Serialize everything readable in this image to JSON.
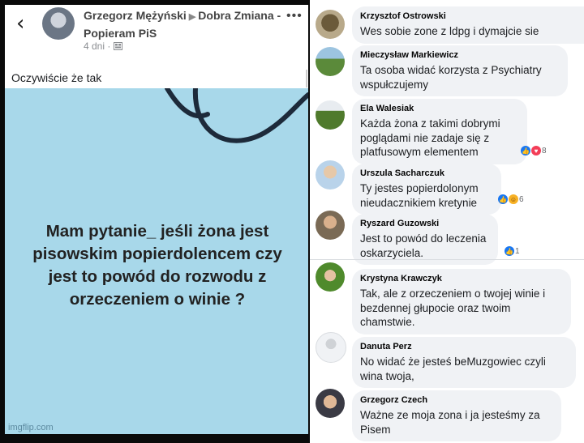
{
  "post": {
    "back_icon": "chevron-left-icon",
    "author": "Grzegorz Mężyński",
    "arrow": "▶",
    "group": "Dobra Zmiana - Popieram PiS",
    "time": "4 dni",
    "audience_icon": "group-icon",
    "menu_icon": "more-dots-icon",
    "menu_glyph": "•••",
    "text": "Oczywiście że tak",
    "image_text": "Mam pytanie_ jeśli żona jest pisowskim popierdolencem czy jest to powód do rozwodu z orzeczeniem o winie ?",
    "watermark": "imgflip.com"
  },
  "comments": [
    {
      "name": "Krzysztof Ostrowski",
      "text": "Wes sobie zone z ldpg i dymajcie sie",
      "reactions": ""
    },
    {
      "name": "Mieczysław Markiewicz",
      "text": "Ta osoba widać korzysta z Psychiatry wspułczujemy",
      "reactions": ""
    },
    {
      "name": "Ela Walesiak",
      "text": "Każda żona z takimi dobrymi poglądami nie zadaje się z platfusowym elementem",
      "reactions": "8"
    },
    {
      "name": "Urszula Sacharczuk",
      "text": "Ty jestes popierdolonym nieudacznikiem kretynie",
      "reactions": "6"
    },
    {
      "name": "Ryszard Guzowski",
      "text": "Jest to powód do leczenia oskarzyciela.",
      "reactions": "1"
    },
    {
      "name": "Krystyna Krawczyk",
      "text": "Tak, ale z orzeczeniem o twojej winie i bezdennej głupocie oraz twoim chamstwie.",
      "reactions": ""
    },
    {
      "name": "Danuta Perz",
      "text": "No widać że jesteś beMuzgowiec czyli wina twoja,",
      "reactions": ""
    },
    {
      "name": "Grzegorz Czech",
      "text": "Ważne  ze moja zona i ja jesteśmy za Pisem",
      "reactions": ""
    }
  ],
  "colors": {
    "image_bg": "#a8d8ea",
    "bubble_bg": "#f0f2f5",
    "like_blue": "#1877f2",
    "haha_yellow": "#f7b125",
    "love_red": "#f33e58"
  }
}
